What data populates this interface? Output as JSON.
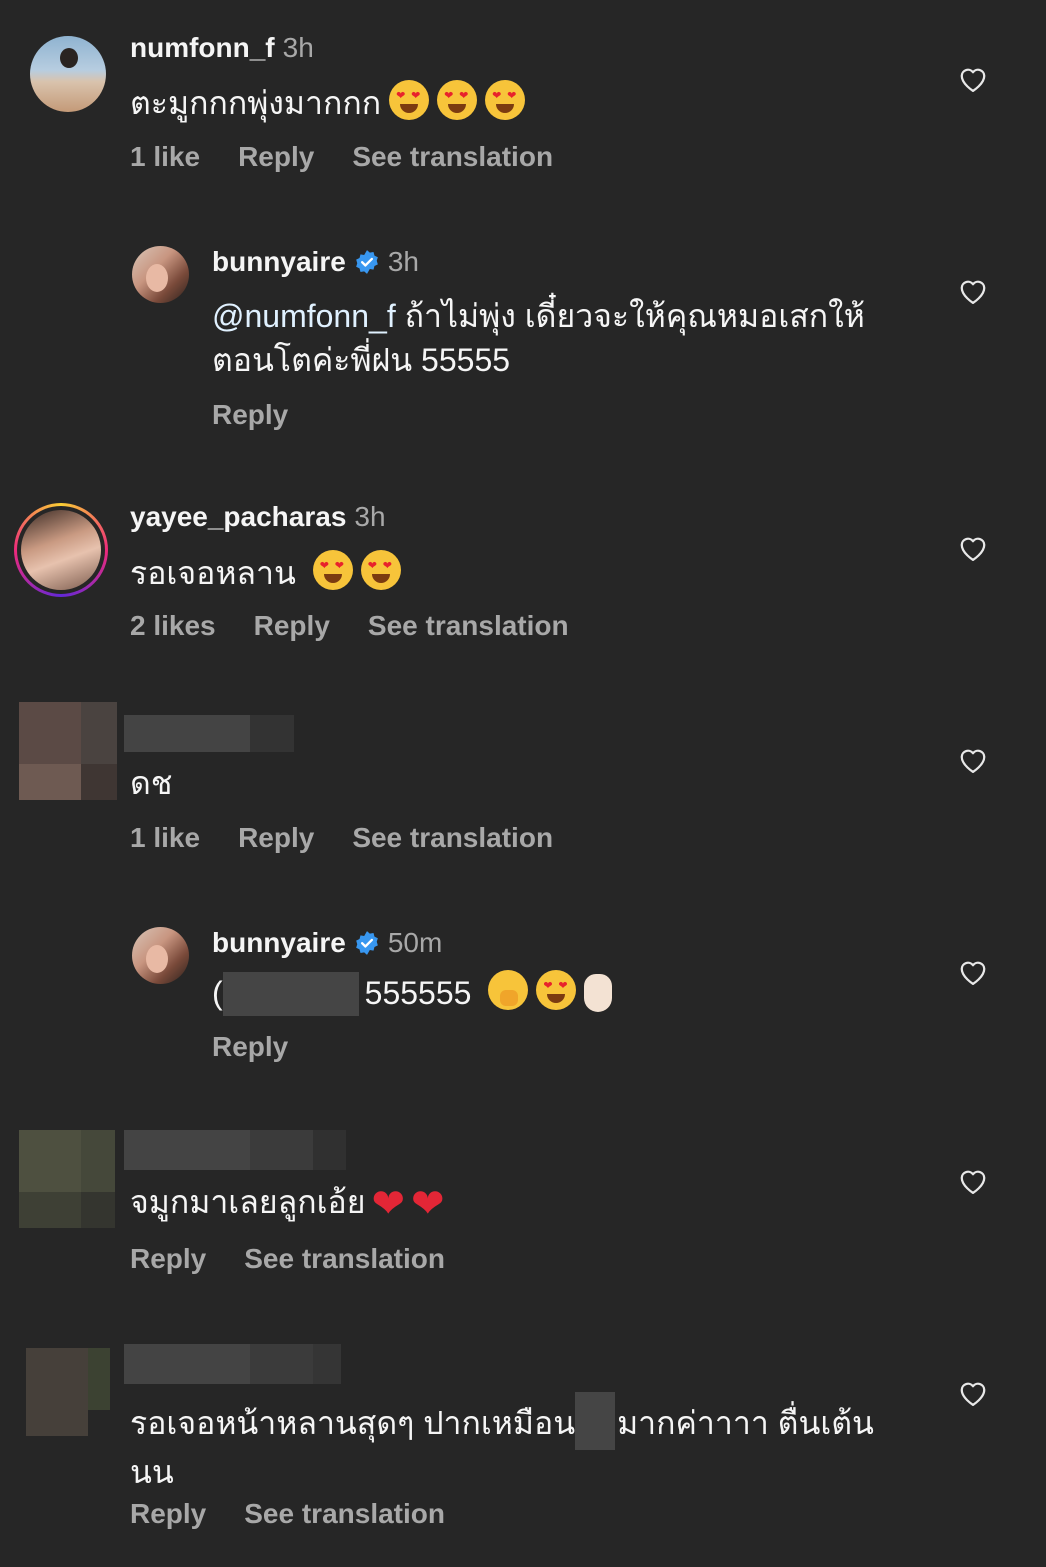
{
  "comments": [
    {
      "username": "numfonn_f",
      "time": "3h",
      "text": "ตะมูกกกพุ่งมากกก",
      "likes": "1 like",
      "reply": "Reply",
      "translate": "See translation"
    },
    {
      "username": "bunnyaire",
      "time": "3h",
      "mention": "@numfonn_f",
      "text": " ถ้าไม่พุ่ง เดี๋ยวจะให้คุณหมอเสกให้ตอนโตค่ะพี่ฝน 55555",
      "reply": "Reply"
    },
    {
      "username": "yayee_pacharas",
      "time": "3h",
      "text": "รอเจอหลาน",
      "likes": "2 likes",
      "reply": "Reply",
      "translate": "See translation"
    },
    {
      "text": "ดช",
      "likes": "1 like",
      "reply": "Reply",
      "translate": "See translation"
    },
    {
      "username": "bunnyaire",
      "time": "50m",
      "prefix": "(",
      "text": "555555",
      "reply": "Reply"
    },
    {
      "text": "จมูกมาเลยลูกเอ้ย",
      "reply": "Reply",
      "translate": "See translation"
    },
    {
      "text_a": "รอเจอหน้าหลานสุดๆ ปากเหมือน",
      "text_b": "มากค่าาาา ตื่นเต้นนน",
      "reply": "Reply",
      "translate": "See translation"
    }
  ],
  "icons": {
    "like": "heart-outline-icon",
    "verified": "verified-badge-icon"
  },
  "colors": {
    "background": "#262626",
    "secondary_text": "#a8a8a8",
    "verified": "#3897f0"
  }
}
